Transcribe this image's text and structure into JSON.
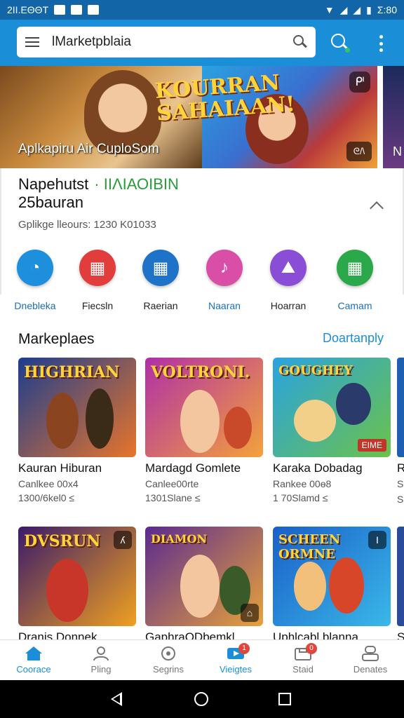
{
  "status": {
    "time_left": "2ΙΙ.ΕΘΘΤ",
    "time_right": "Σ:80"
  },
  "search": {
    "value": "lMarketpblaia",
    "placeholder": ""
  },
  "banner": {
    "headline_line1": "KOURRAN",
    "headline_line2": "SAHAIAAN!",
    "caption": "Aplkapiru Air CuploSom",
    "lock_icon": "ᒆ",
    "badge": "ᘓ/\\",
    "peek_letter": "N"
  },
  "info": {
    "title": "Napehutst",
    "title_green": "· ΙΙΛΙΑΟΙΒΙΝ",
    "subtitle": "25bauran",
    "meta": "Gplikge lleours: 1230 K01033"
  },
  "apps": [
    {
      "label": "Dnebleka",
      "color": "#1e8fdc",
      "glyph": "◔"
    },
    {
      "label": "Fiecsln",
      "color": "#e23d3d",
      "glyph": "▦"
    },
    {
      "label": "Raerian",
      "color": "#1e73c8",
      "glyph": "▦"
    },
    {
      "label": "Naaran",
      "color": "#d94fa8",
      "glyph": "♪"
    },
    {
      "label": "Hoarran",
      "color": "#8a4dd6",
      "glyph": "⛰"
    },
    {
      "label": "Camam",
      "color": "#2aa84a",
      "glyph": "▦"
    }
  ],
  "section": {
    "title": "Markeplaes",
    "link": "Doartanply"
  },
  "cards": [
    {
      "title_art": "HIGHRIAN",
      "name": "Kauran Hiburan",
      "dev": "Canlkee 00x4",
      "rating": "1300/6kel0 ≤",
      "colors": [
        "#1b3d8f",
        "#e8742a"
      ]
    },
    {
      "title_art": "VOLTRONI.",
      "name": "Mardagd Gomlete",
      "dev": "Canlee00rte",
      "rating": "1301Slane ≤",
      "colors": [
        "#b02fa7",
        "#f4a23a"
      ],
      "tag": ""
    },
    {
      "title_art": "GOUGHEY",
      "name": "Karaka Dobadag",
      "dev": "Rankee 00ɵ8",
      "rating": "1 70Slamd ≤",
      "colors": [
        "#29a3e0",
        "#6cc24a"
      ],
      "tag": "ΕΙΜΕ"
    },
    {
      "title_art": "DVSRUN",
      "name": "Dranis Donnek",
      "dev": "",
      "rating": "",
      "colors": [
        "#3a1a6a",
        "#f0a020"
      ],
      "icon": "ʎ"
    },
    {
      "title_art": "DIAMON",
      "name": "GaphraQDbemkl",
      "dev": "",
      "rating": "",
      "colors": [
        "#5a2a90",
        "#e8a23a"
      ],
      "icon": "⌂"
    },
    {
      "title_art": "SCHEEN ORMNE",
      "name": "Uphlcabl.blanna",
      "dev": "",
      "rating": "",
      "colors": [
        "#1a5fc8",
        "#3ab8e8"
      ],
      "icon": "Ι"
    }
  ],
  "edge": {
    "row1_text": "R",
    "row2_text": "S",
    "row1_sub": "S",
    "row1_sub2": "S"
  },
  "nav": [
    {
      "label": "Coorace",
      "active": true,
      "badge": ""
    },
    {
      "label": "Pling",
      "active": false,
      "badge": ""
    },
    {
      "label": "Segrins",
      "active": false,
      "badge": ""
    },
    {
      "label": "Vieigtes",
      "active": true,
      "badge": "1"
    },
    {
      "label": "Staid",
      "active": false,
      "badge": "0"
    },
    {
      "label": "Denates",
      "active": false,
      "badge": ""
    }
  ]
}
